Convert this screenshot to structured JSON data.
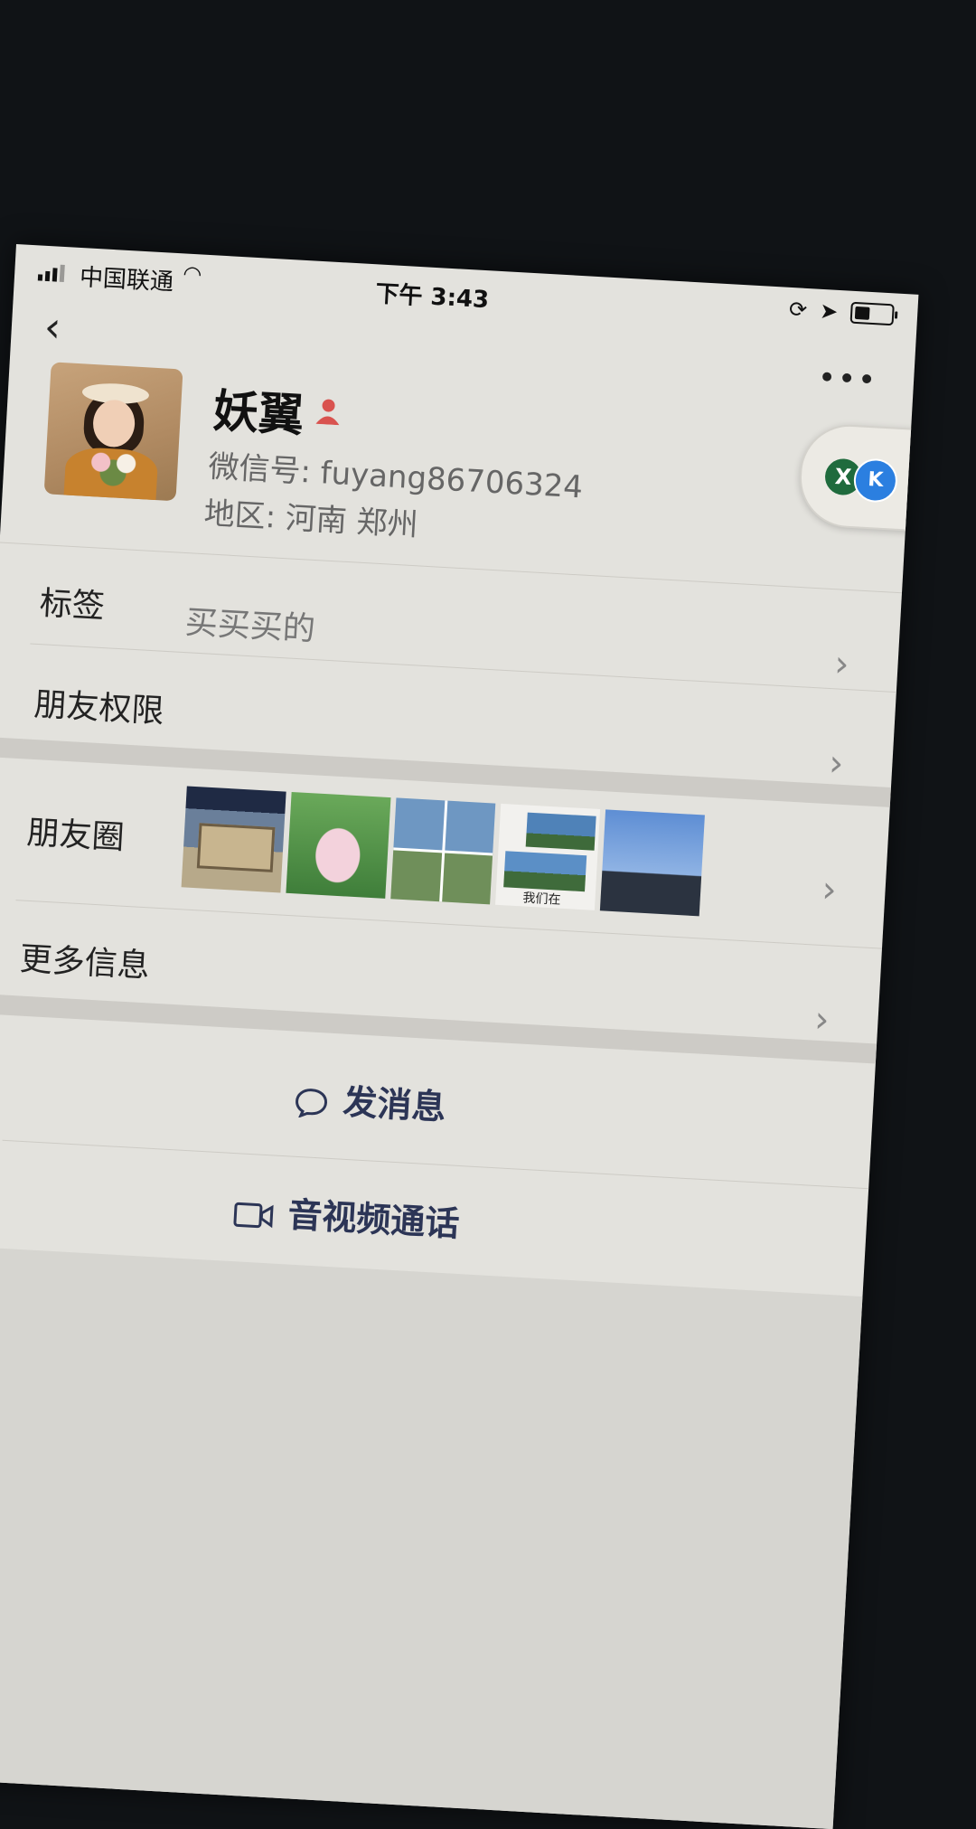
{
  "status_bar": {
    "carrier": "中国联通",
    "time": "下午 3:43"
  },
  "profile": {
    "name": "妖翼",
    "wechat_id": "微信号: fuyang86706324",
    "region": "地区: 河南 郑州"
  },
  "rows": {
    "tags_label": "标签",
    "tags_value": "买买买的",
    "permissions_label": "朋友权限",
    "moments_label": "朋友圈",
    "more_info_label": "更多信息"
  },
  "moments": {
    "thumb4_caption": "我们在"
  },
  "actions": {
    "message_label": "发消息",
    "call_label": "音视频通话"
  },
  "icons": {
    "back": "chevron-left-icon",
    "more": "more-dots-icon",
    "chevron": "chevron-right-icon",
    "message": "chat-bubble-icon",
    "video": "video-camera-icon"
  },
  "colors": {
    "accent_text": "#2c3556",
    "person_icon": "#d9534f",
    "float_x": "#1f6b3d",
    "float_k": "#2b7fe0"
  }
}
